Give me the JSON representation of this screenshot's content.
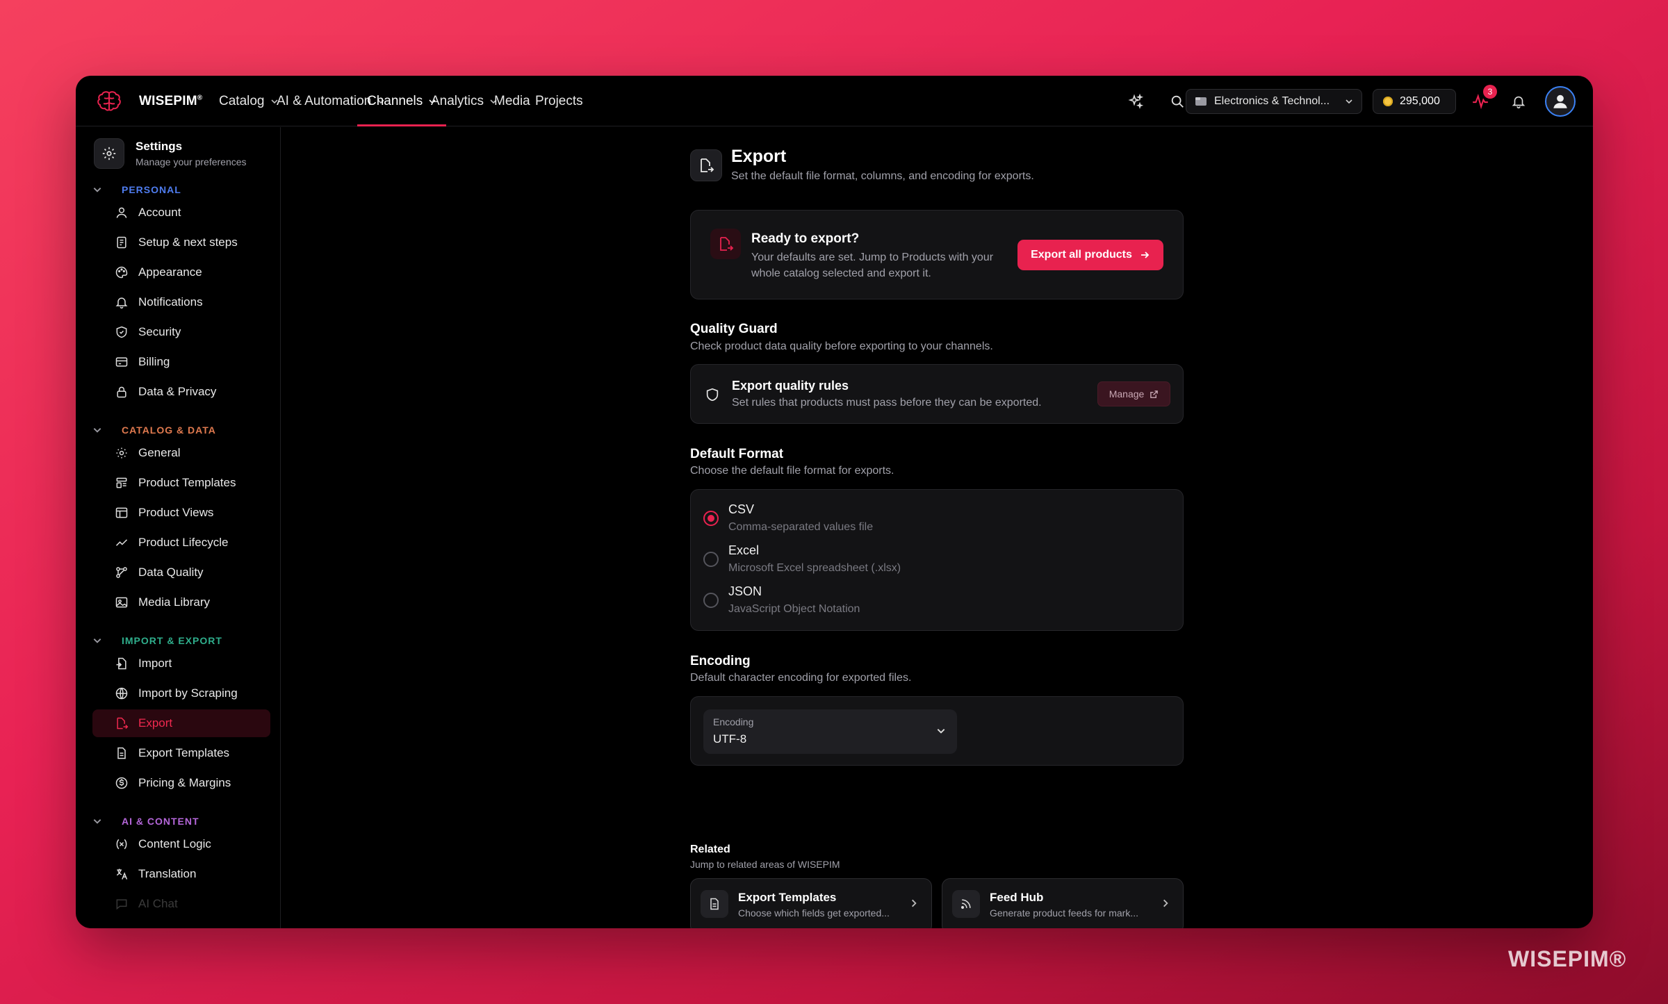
{
  "brand": {
    "name": "WISEPIM",
    "mark": "®"
  },
  "topnav": {
    "items": [
      {
        "label": "Catalog",
        "dropdown": true
      },
      {
        "label": "AI & Automation",
        "dropdown": true
      },
      {
        "label": "Channels",
        "dropdown": true,
        "active": true
      },
      {
        "label": "Analytics",
        "dropdown": true
      },
      {
        "label": "Media"
      },
      {
        "label": "Projects"
      }
    ],
    "workspace": "Electronics & Technol...",
    "credits": "295,000",
    "activity_badge": "3",
    "icons": [
      "sparkles-icon",
      "search-icon",
      "activity-icon",
      "bell-icon",
      "user-icon"
    ]
  },
  "sidebar": {
    "title": "Settings",
    "subtitle": "Manage your preferences",
    "sections": [
      {
        "label": "PERSONAL",
        "color": "#4f7df0",
        "items": [
          "Account",
          "Setup & next steps",
          "Appearance",
          "Notifications",
          "Security",
          "Billing",
          "Data & Privacy"
        ]
      },
      {
        "label": "CATALOG & DATA",
        "color": "#e07a4f",
        "items": [
          "General",
          "Product Templates",
          "Product Views",
          "Product Lifecycle",
          "Data Quality",
          "Media Library"
        ]
      },
      {
        "label": "IMPORT & EXPORT",
        "color": "#2fae8c",
        "items": [
          "Import",
          "Import by Scraping",
          "Export",
          "Export Templates",
          "Pricing & Margins"
        ]
      },
      {
        "label": "AI & CONTENT",
        "color": "#b466d9",
        "items": [
          "Content Logic",
          "Translation",
          "AI Chat"
        ]
      }
    ],
    "active_item": "Export"
  },
  "page": {
    "title": "Export",
    "subtitle": "Set the default file format, columns, and encoding for exports.",
    "ready": {
      "title": "Ready to export?",
      "description": "Your defaults are set. Jump to Products with your whole catalog selected and export it.",
      "button": "Export all products"
    },
    "quality_guard": {
      "title": "Quality Guard",
      "description": "Check product data quality before exporting to your channels.",
      "rule_title": "Export quality rules",
      "rule_desc": "Set rules that products must pass before they can be exported.",
      "button": "Manage"
    },
    "default_format": {
      "title": "Default Format",
      "description": "Choose the default file format for exports.",
      "options": [
        {
          "label": "CSV",
          "desc": "Comma-separated values file",
          "selected": true
        },
        {
          "label": "Excel",
          "desc": "Microsoft Excel spreadsheet (.xlsx)",
          "selected": false
        },
        {
          "label": "JSON",
          "desc": "JavaScript Object Notation",
          "selected": false
        }
      ]
    },
    "encoding": {
      "title": "Encoding",
      "description": "Default character encoding for exported files.",
      "field_label": "Encoding",
      "value": "UTF-8"
    },
    "related": {
      "title": "Related",
      "subtitle": "Jump to related areas of WISEPIM",
      "cards": [
        {
          "title": "Export Templates",
          "desc": "Choose which fields get exported..."
        },
        {
          "title": "Feed Hub",
          "desc": "Generate product feeds for mark..."
        }
      ]
    }
  },
  "watermark": "WISEPIM®",
  "colors": {
    "accent": "#e8224f",
    "background": "#000000",
    "card": "#131315"
  }
}
